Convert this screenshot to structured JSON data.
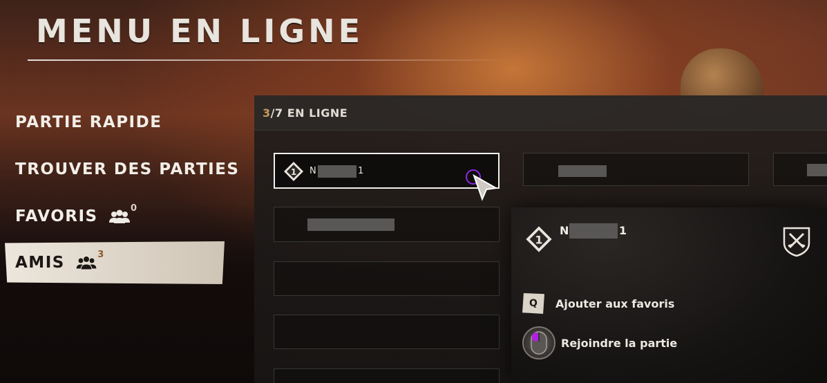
{
  "page": {
    "title": "MENU EN LIGNE"
  },
  "nav": {
    "items": [
      {
        "label": "PARTIE RAPIDE"
      },
      {
        "label": "TROUVER DES PARTIES"
      },
      {
        "label": "FAVORIS",
        "count": "0"
      },
      {
        "label": "AMIS",
        "count": "3"
      }
    ],
    "active_index": 3
  },
  "panel": {
    "online_current": "3",
    "online_rest": "/7 EN LIGNE",
    "slots": [
      {
        "name_first": "N",
        "name_last": "1",
        "rank": "1"
      }
    ]
  },
  "popup": {
    "name_first": "N",
    "name_last": "1",
    "rank": "1",
    "actions": [
      {
        "key": "Q",
        "label": "Ajouter aux favoris"
      },
      {
        "key": "mouse-left",
        "label": "Rejoindre la partie"
      }
    ]
  },
  "colors": {
    "accent": "#c79a5d",
    "cursor": "#8a2be2",
    "active_tab": "#ece6dc"
  },
  "icons": [
    "people-icon",
    "rank-diamond-icon",
    "crossed-swords-icon",
    "mouse-button-icon",
    "pointer-cursor-icon"
  ]
}
